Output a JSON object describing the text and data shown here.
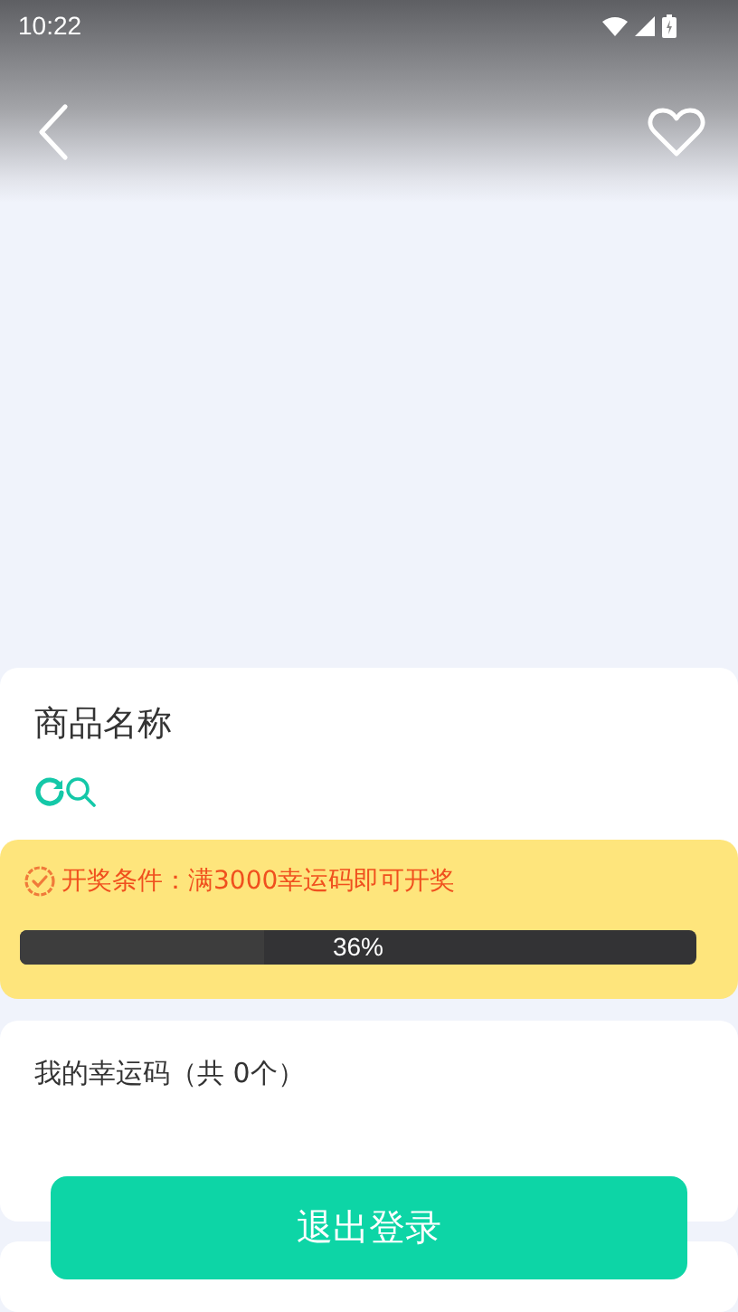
{
  "status_bar": {
    "time": "10:22"
  },
  "product": {
    "name": "商品名称"
  },
  "draw_condition": {
    "text": "开奖条件：满3000幸运码即可开奖"
  },
  "progress": {
    "level": 0.36,
    "reading": "36%"
  },
  "my_codes": {
    "title": "我的幸运码（共 0个）"
  },
  "logout_button": {
    "label": "退出登录"
  }
}
